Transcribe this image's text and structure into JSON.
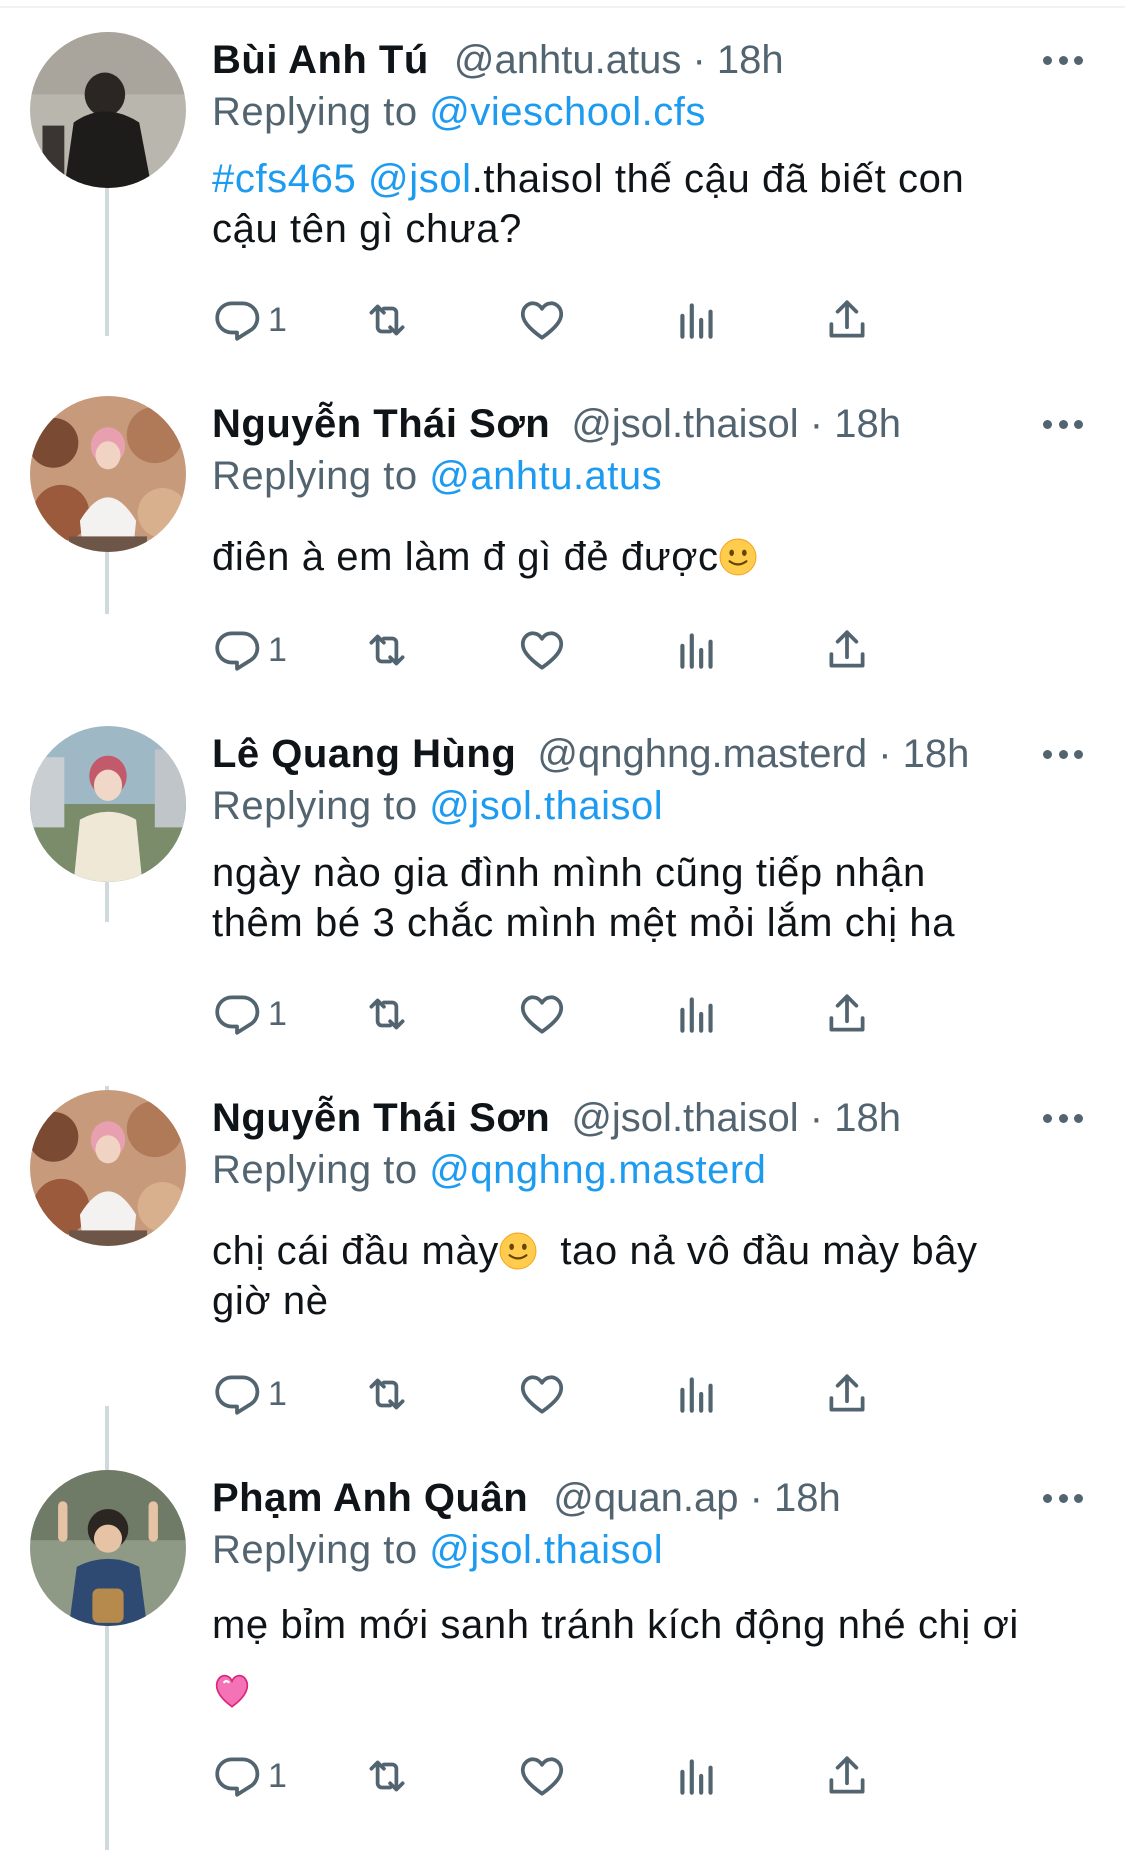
{
  "icons": {
    "reply": "speech-bubble-icon",
    "retweet": "retweet-icon",
    "like": "heart-icon",
    "views": "bar-chart-icon",
    "share": "share-upload-icon",
    "more": "ellipsis-icon"
  },
  "colors": {
    "link": "#1d9bf0",
    "secondary_text": "#536471",
    "primary_text": "#0f1419",
    "thread_line": "#cfd9de"
  },
  "tweets": [
    {
      "name": "Bùi Anh Tú",
      "handle": "@anhtu.atus",
      "dot": " · ",
      "time": "18h",
      "replying_label": "Replying to ",
      "replying_to": "@vieschool.cfs",
      "hashtag": "#cfs465",
      "mention": "@jsol",
      "text_line1_rest": ".thaisol thế cậu đã biết con",
      "text_line2": "cậu tên gì chưa?",
      "reply_count": "1"
    },
    {
      "name": "Nguyễn Thái Sơn",
      "handle": "@jsol.thaisol",
      "dot": " · ",
      "time": "18h",
      "replying_label": "Replying to ",
      "replying_to": "@anhtu.atus",
      "text": "điên à em làm đ gì đẻ được",
      "emoji": "slightly-smiling-face",
      "reply_count": "1"
    },
    {
      "name": "Lê Quang Hùng",
      "handle": "@qnghng.masterd",
      "dot": " · ",
      "time": "18h",
      "replying_label": "Replying to ",
      "replying_to": "@jsol.thaisol",
      "text_line1": "ngày nào gia đình mình cũng tiếp nhận",
      "text_line2": "thêm bé 3 chắc mình mệt mỏi lắm chị ha",
      "reply_count": "1"
    },
    {
      "name": "Nguyễn Thái Sơn",
      "handle": "@jsol.thaisol",
      "dot": " · ",
      "time": "18h",
      "replying_label": "Replying to ",
      "replying_to": "@qnghng.masterd",
      "text_line1_a": "chị cái đầu mày",
      "emoji": "slightly-smiling-face",
      "text_line1_b": "  tao nả vô đầu mày bây",
      "text_line2": "giờ nè",
      "reply_count": "1"
    },
    {
      "name": "Phạm Anh Quân",
      "handle": "@quan.ap",
      "dot": " · ",
      "time": "18h",
      "replying_label": "Replying to ",
      "replying_to": "@jsol.thaisol",
      "text_line1": "mẹ bỉm mới sanh tránh kích động nhé chị ơi",
      "emoji": "sparkling-heart",
      "reply_count": "1"
    }
  ]
}
